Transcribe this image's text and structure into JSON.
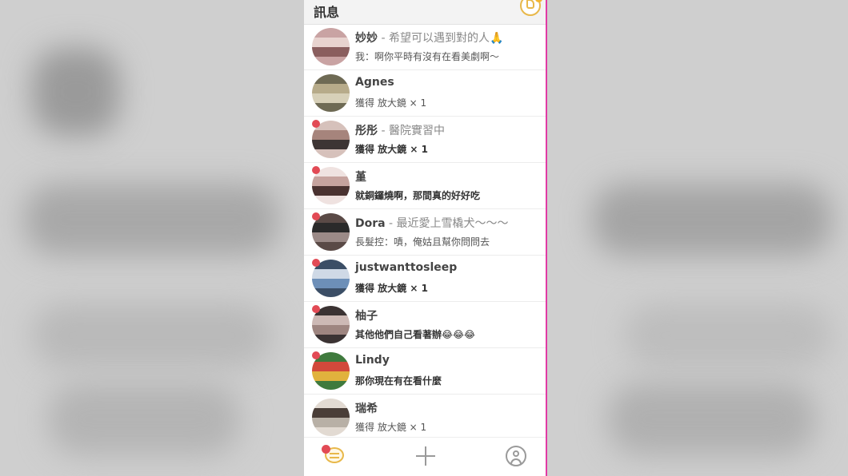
{
  "header": {
    "title": "訊息",
    "action_icon": "boost-icon",
    "accent": "#e8b84a"
  },
  "conversations": [
    {
      "name": "妙妙",
      "status": "希望可以遇到對的人🙏",
      "message": "我：啊你平時有沒有在看美劇啊～",
      "bold": false,
      "unread": false,
      "avatar_colors": [
        "#c9a3a3",
        "#8a5e5e",
        "#e8d3cf"
      ]
    },
    {
      "name": "Agnes",
      "status": "",
      "message": "獲得 放大鏡 × 1",
      "bold": false,
      "unread": false,
      "avatar_colors": [
        "#b7ab8a",
        "#6e6a54",
        "#d7d0b8"
      ]
    },
    {
      "name": "彤彤",
      "status": "醫院實習中",
      "message": "獲得 放大鏡 × 1",
      "bold": true,
      "unread": true,
      "avatar_colors": [
        "#3d3534",
        "#a6847c",
        "#d6c1bb"
      ]
    },
    {
      "name": "堇",
      "status": "",
      "message": "就銅鑼燒啊，那間真的好好吃",
      "bold": true,
      "unread": true,
      "avatar_colors": [
        "#efe2e0",
        "#4a3230",
        "#c6a39e"
      ]
    },
    {
      "name": "Dora",
      "status": "最近愛上雪橇犬～～～",
      "message": "長髮控：嘖，俺姑且幫你問問去",
      "bold": false,
      "unread": true,
      "avatar_colors": [
        "#2a2a2a",
        "#5a4a46",
        "#9b8a87"
      ]
    },
    {
      "name": "justwanttosleep",
      "status": "",
      "message": "獲得 放大鏡 × 1",
      "bold": true,
      "unread": true,
      "avatar_colors": [
        "#6d8fb8",
        "#cfd9e6",
        "#3b4e66"
      ]
    },
    {
      "name": "柚子",
      "status": "",
      "message": "其他他們自己看著辦😂😂😂",
      "bold": true,
      "unread": true,
      "avatar_colors": [
        "#3b3333",
        "#9e8580",
        "#cdb9b5"
      ]
    },
    {
      "name": "Lindy",
      "status": "",
      "message": "那你現在有在看什麼",
      "bold": true,
      "unread": true,
      "avatar_colors": [
        "#d2493b",
        "#3f7a3d",
        "#e1b23d"
      ]
    },
    {
      "name": "瑞希",
      "status": "",
      "message": "獲得 放大鏡 × 1",
      "bold": false,
      "unread": false,
      "avatar_colors": [
        "#b8b0a6",
        "#4a3e38",
        "#e2dad2"
      ]
    }
  ],
  "tabbar": {
    "items": [
      {
        "name": "messages",
        "icon": "chat-bubble-icon",
        "active": true
      },
      {
        "name": "add",
        "icon": "plus-icon",
        "active": false
      },
      {
        "name": "profile",
        "icon": "user-icon",
        "active": false
      }
    ],
    "active_color": "#e8b84a",
    "inactive_color": "#9a9a9a"
  },
  "colors": {
    "phone_border": "#e23aa5",
    "unread_dot": "#e24a55"
  }
}
